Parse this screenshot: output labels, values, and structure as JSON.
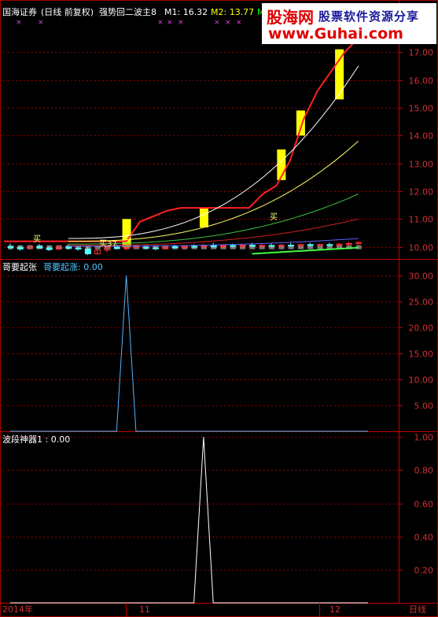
{
  "header": {
    "broker": "国海证券",
    "mode": "(日线 前复权)",
    "indicator": "强势回二波主8",
    "m1_label": "M1: 16.32",
    "m2_label": "M2: 13.77",
    "m3_label": "M"
  },
  "watermark": {
    "line1": "股海网",
    "line2": "股票软件资源分享",
    "line3": "www.Guhai.com"
  },
  "panel2": {
    "name": "哥要起张",
    "value_label": "哥要起涨: 0.00"
  },
  "panel3": {
    "name": "波段神器1",
    "value_label": "波段神器1 : 0.00"
  },
  "x_axis": {
    "labels": [
      "2014年",
      "11",
      "12"
    ],
    "period_label": "日线"
  },
  "chart_markers": {
    "buy_labels": [
      "买",
      "买37",
      "买"
    ]
  },
  "colors": {
    "up": "#ff3232",
    "down": "#54ffff",
    "boost": "#ffff00",
    "red_line": "#ff2020",
    "grid": "#8b0000",
    "axis_text": "#d03030"
  },
  "chart_data": [
    {
      "type": "candlestick",
      "ylim": [
        9.65,
        18.25
      ],
      "yticks": [
        10.0,
        11.0,
        12.0,
        13.0,
        14.0,
        15.0,
        16.0,
        17.0
      ],
      "candles": [
        {
          "o": 10.0,
          "h": 10.12,
          "l": 9.9,
          "c": 9.98
        },
        {
          "o": 9.98,
          "h": 10.05,
          "l": 9.86,
          "c": 9.92
        },
        {
          "o": 9.95,
          "h": 10.08,
          "l": 9.9,
          "c": 10.02
        },
        {
          "o": 10.02,
          "h": 10.1,
          "l": 9.94,
          "c": 9.96
        },
        {
          "o": 9.96,
          "h": 10.02,
          "l": 9.85,
          "c": 9.9
        },
        {
          "o": 9.92,
          "h": 10.04,
          "l": 9.88,
          "c": 10.0
        },
        {
          "o": 10.0,
          "h": 10.1,
          "l": 9.9,
          "c": 9.95
        },
        {
          "o": 9.95,
          "h": 10.05,
          "l": 9.86,
          "c": 9.92
        },
        {
          "o": 9.92,
          "h": 10.0,
          "l": 9.7,
          "c": 9.75
        },
        {
          "o": 9.75,
          "h": 9.92,
          "l": 9.72,
          "c": 9.88
        },
        {
          "o": 9.88,
          "h": 10.05,
          "l": 9.8,
          "c": 9.98
        },
        {
          "o": 9.98,
          "h": 10.1,
          "l": 9.9,
          "c": 9.94
        },
        {
          "o": 9.94,
          "h": 10.02,
          "l": 9.88,
          "c": 9.97
        },
        {
          "o": 9.97,
          "h": 10.08,
          "l": 9.92,
          "c": 10.02
        },
        {
          "o": 9.98,
          "h": 10.05,
          "l": 9.9,
          "c": 9.96
        },
        {
          "o": 9.96,
          "h": 10.0,
          "l": 9.88,
          "c": 9.93
        },
        {
          "o": 9.93,
          "h": 10.05,
          "l": 9.9,
          "c": 10.0
        },
        {
          "o": 10.0,
          "h": 10.08,
          "l": 9.92,
          "c": 9.97
        },
        {
          "o": 9.97,
          "h": 10.05,
          "l": 9.9,
          "c": 10.02
        },
        {
          "o": 10.02,
          "h": 10.1,
          "l": 9.95,
          "c": 10.0
        },
        {
          "o": 10.0,
          "h": 10.12,
          "l": 9.94,
          "c": 10.05
        },
        {
          "o": 10.05,
          "h": 10.15,
          "l": 9.98,
          "c": 10.0
        },
        {
          "o": 10.0,
          "h": 10.1,
          "l": 9.94,
          "c": 10.05
        },
        {
          "o": 10.05,
          "h": 10.12,
          "l": 9.98,
          "c": 10.02
        },
        {
          "o": 10.02,
          "h": 10.1,
          "l": 9.95,
          "c": 10.06
        },
        {
          "o": 10.06,
          "h": 10.15,
          "l": 10.0,
          "c": 10.02
        },
        {
          "o": 10.02,
          "h": 10.1,
          "l": 9.96,
          "c": 10.05
        },
        {
          "o": 10.05,
          "h": 10.12,
          "l": 9.98,
          "c": 10.03
        },
        {
          "o": 10.03,
          "h": 10.1,
          "l": 9.97,
          "c": 10.06
        },
        {
          "o": 10.06,
          "h": 10.14,
          "l": 10.0,
          "c": 10.04
        },
        {
          "o": 10.04,
          "h": 10.12,
          "l": 9.98,
          "c": 10.08
        },
        {
          "o": 10.08,
          "h": 10.15,
          "l": 10.0,
          "c": 10.05
        },
        {
          "o": 10.05,
          "h": 10.12,
          "l": 9.98,
          "c": 10.08
        },
        {
          "o": 10.08,
          "h": 10.15,
          "l": 10.02,
          "c": 10.06
        },
        {
          "o": 10.06,
          "h": 10.14,
          "l": 10.0,
          "c": 10.1
        },
        {
          "o": 10.1,
          "h": 10.18,
          "l": 10.04,
          "c": 10.12
        },
        {
          "o": 10.12,
          "h": 10.2,
          "l": 10.06,
          "c": 10.16
        }
      ],
      "boost_candles": [
        {
          "start": 12,
          "end": 12,
          "o": 10.0,
          "c": 11.0
        },
        {
          "start": 20,
          "end": 20,
          "o": 10.7,
          "c": 11.4
        },
        {
          "start": 28,
          "end": 28,
          "o": 12.4,
          "c": 13.5
        },
        {
          "start": 30,
          "end": 30,
          "o": 14.0,
          "c": 14.9
        },
        {
          "start": 34,
          "end": 34,
          "o": 15.3,
          "c": 17.1
        },
        {
          "start": 35,
          "end": 35,
          "o": 17.5,
          "c": 18.3
        }
      ],
      "red_line": [
        10.2,
        10.2,
        10.2,
        10.2,
        10.2,
        10.2,
        10.2,
        10.2,
        10.2,
        10.2,
        10.2,
        10.2,
        10.2,
        10.9,
        11.1,
        11.3,
        11.4,
        11.4,
        11.4,
        11.4,
        11.4,
        11.4,
        11.9,
        12.2,
        13.1,
        14.6,
        15.6,
        16.3,
        17.0,
        17.5
      ]
    },
    {
      "type": "line",
      "title": "哥要起张",
      "ylim": [
        0,
        33
      ],
      "yticks": [
        5.0,
        10.0,
        15.0,
        20.0,
        25.0,
        30.0
      ],
      "x": [
        0,
        11,
        12,
        13,
        37
      ],
      "values": [
        0,
        0,
        30,
        0,
        0
      ]
    },
    {
      "type": "line",
      "title": "波段神器1",
      "ylim": [
        0,
        1.03
      ],
      "yticks": [
        0.2,
        0.4,
        0.6,
        0.8,
        1.0
      ],
      "x": [
        0,
        19,
        20,
        21,
        37
      ],
      "values": [
        0,
        0,
        1,
        0,
        0
      ]
    }
  ]
}
